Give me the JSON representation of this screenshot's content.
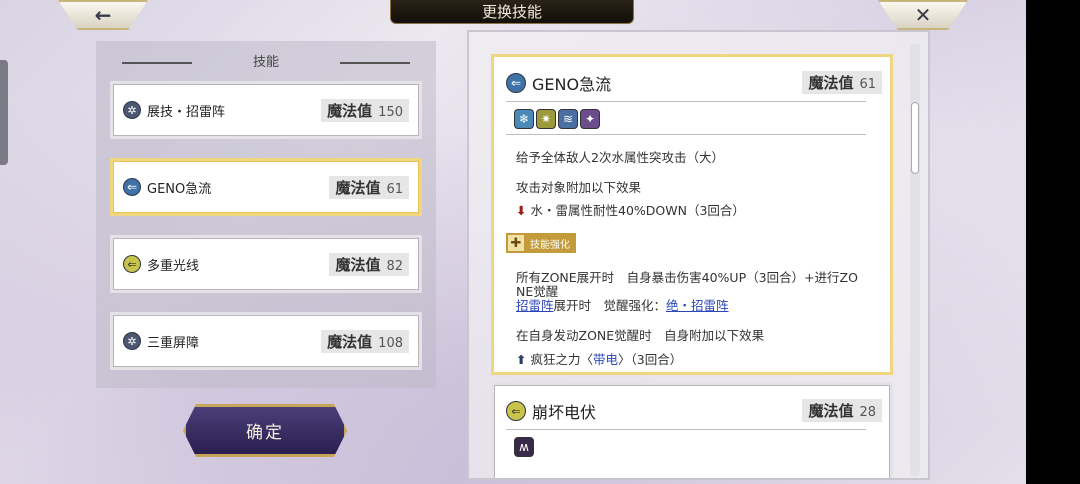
{
  "header": {
    "back_icon": "←",
    "title": "更换技能",
    "close_icon": "✕"
  },
  "left_panel": {
    "title": "技能",
    "skills": [
      {
        "name": "展技・招雷阵",
        "mp_label": "魔法值",
        "mp": "150",
        "icon": "gear-icon"
      },
      {
        "name": "GENO急流",
        "mp_label": "魔法值",
        "mp": "61",
        "icon": "blue-arrow-icon"
      },
      {
        "name": "多重光线",
        "mp_label": "魔法值",
        "mp": "82",
        "icon": "yellow-arrow-icon"
      },
      {
        "name": "三重屏障",
        "mp_label": "魔法值",
        "mp": "108",
        "icon": "gear-icon"
      }
    ],
    "confirm_label": "确定"
  },
  "detail": {
    "name": "GENO急流",
    "mp_label": "魔法值",
    "mp": "61",
    "attributes": [
      "water-attribute-icon",
      "thunder-attribute-icon",
      "multi-hit-icon",
      "special-icon"
    ],
    "desc1": "给予全体敌人2次水属性突攻击（大）",
    "desc2": "攻击对象附加以下效果",
    "debuff": "水・雷属性耐性40%DOWN（3回合）",
    "enhance_badge": "技能强化",
    "zone_line1": "所有ZONE展开时　自身暴击伤害40%UP（3回合）+进行ZO",
    "zone_line2": "NE觉醒",
    "zone_link": "招雷阵",
    "zone_mid": "展开时　觉醒强化：",
    "zone_link2": "绝・招雷阵",
    "awaken_line": "在自身发动ZONE觉醒时　自身附加以下效果",
    "buff_pre": "疯狂之力〈",
    "buff_link": "带电",
    "buff_post": "〉（3回合）"
  },
  "next_card": {
    "name": "崩坏电伏",
    "mp_label": "魔法值",
    "mp": "28"
  }
}
